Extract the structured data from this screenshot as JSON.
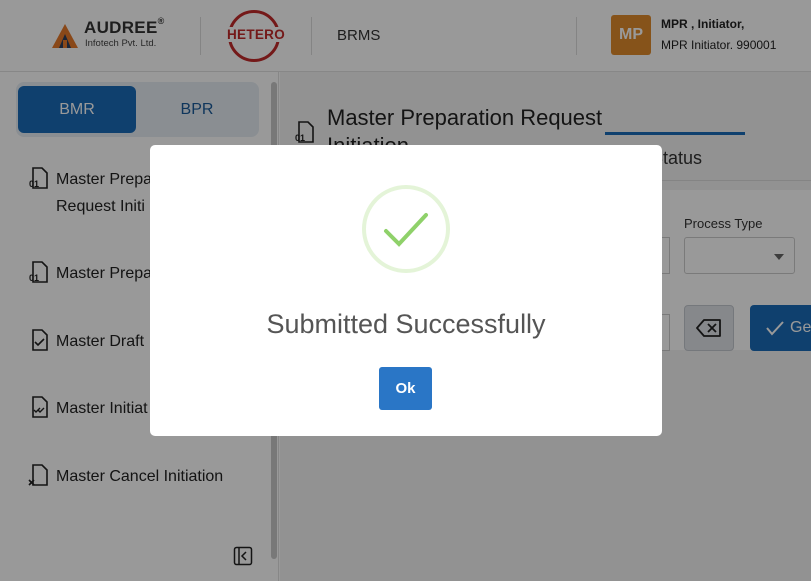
{
  "header": {
    "audree_name": "AUDREE",
    "audree_reg": "®",
    "audree_sub": "Infotech Pvt. Ltd.",
    "hetero": "HETERO",
    "app_name": "BRMS",
    "avatar_initials": "MP",
    "user_name": "MPR , Initiator,",
    "user_role": "MPR Initiator. 990001"
  },
  "sidebar": {
    "tabs": {
      "bmr": "BMR",
      "bpr": "BPR"
    },
    "items": [
      {
        "line1": "Master Prepa",
        "line2": "Request Initi",
        "icon": "file-01-icon"
      },
      {
        "line1": "Master Prepa",
        "icon": "file-01-icon"
      },
      {
        "line1": "Master Draft",
        "icon": "file-check-icon"
      },
      {
        "line1": "Master Initiat",
        "icon": "file-double-check-icon"
      },
      {
        "line1": "Master Cancel Initiation",
        "icon": "file-x-icon"
      }
    ]
  },
  "main": {
    "title_line1": "Master Preparation Request",
    "title_line2": "Initiation",
    "tab_status": "Status",
    "process_type_label": "Process Type",
    "generate_label": "Ge"
  },
  "modal": {
    "title": "Submitted Successfully",
    "ok": "Ok"
  },
  "colors": {
    "primary": "#1a6bb8",
    "success_check": "#8fd16a",
    "avatar": "#e08a2c",
    "hetero_red": "#c22a2a"
  }
}
